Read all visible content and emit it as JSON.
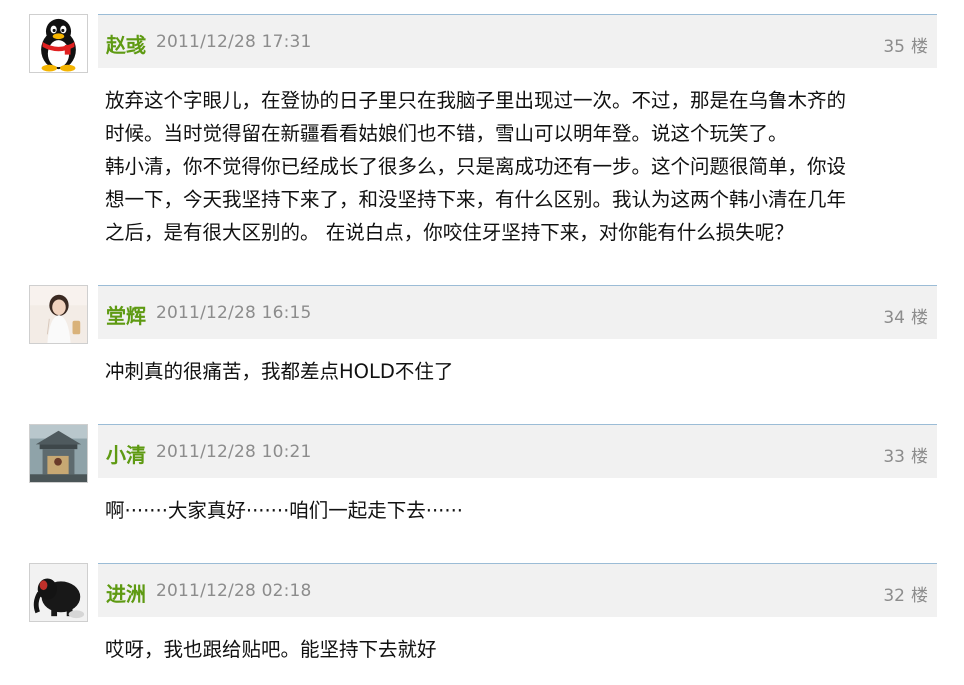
{
  "posts": [
    {
      "username": "赵彧",
      "time": "2011/12/28 17:31",
      "floor_num": "35",
      "floor_unit": "楼",
      "avatar": "qq-penguin-icon",
      "content": [
        "放弃这个字眼儿，在登协的日子里只在我脑子里出现过一次。不过，那是在乌鲁木齐的",
        "时候。当时觉得留在新疆看看姑娘们也不错，雪山可以明年登。说这个玩笑了。",
        "韩小清，你不觉得你已经成长了很多么，只是离成功还有一步。这个问题很简单，你设",
        "想一下，今天我坚持下来了，和没坚持下来，有什么区别。我认为这两个韩小清在几年",
        "之后，是有很大区别的。 在说白点，你咬住牙坚持下来，对你能有什么损失呢？"
      ]
    },
    {
      "username": "堂辉",
      "time": "2011/12/28 16:15",
      "floor_num": "34",
      "floor_unit": "楼",
      "avatar": "girl-photo-avatar",
      "content": [
        "冲刺真的很痛苦，我都差点HOLD不住了"
      ]
    },
    {
      "username": "小清",
      "time": "2011/12/28 10:21",
      "floor_num": "33",
      "floor_unit": "楼",
      "avatar": "temple-photo-avatar",
      "content": [
        "啊·······大家真好·······咱们一起走下去······"
      ]
    },
    {
      "username": "进洲",
      "time": "2011/12/28 02:18",
      "floor_num": "32",
      "floor_unit": "楼",
      "avatar": "plush-elephant-avatar",
      "content": [
        "哎呀，我也跟给贴吧。能坚持下去就好"
      ]
    }
  ],
  "colors": {
    "username": "#5e9a12",
    "meta": "#8c8c8c",
    "header_bg": "#f1f1f1",
    "header_border": "#9bbcd6"
  }
}
